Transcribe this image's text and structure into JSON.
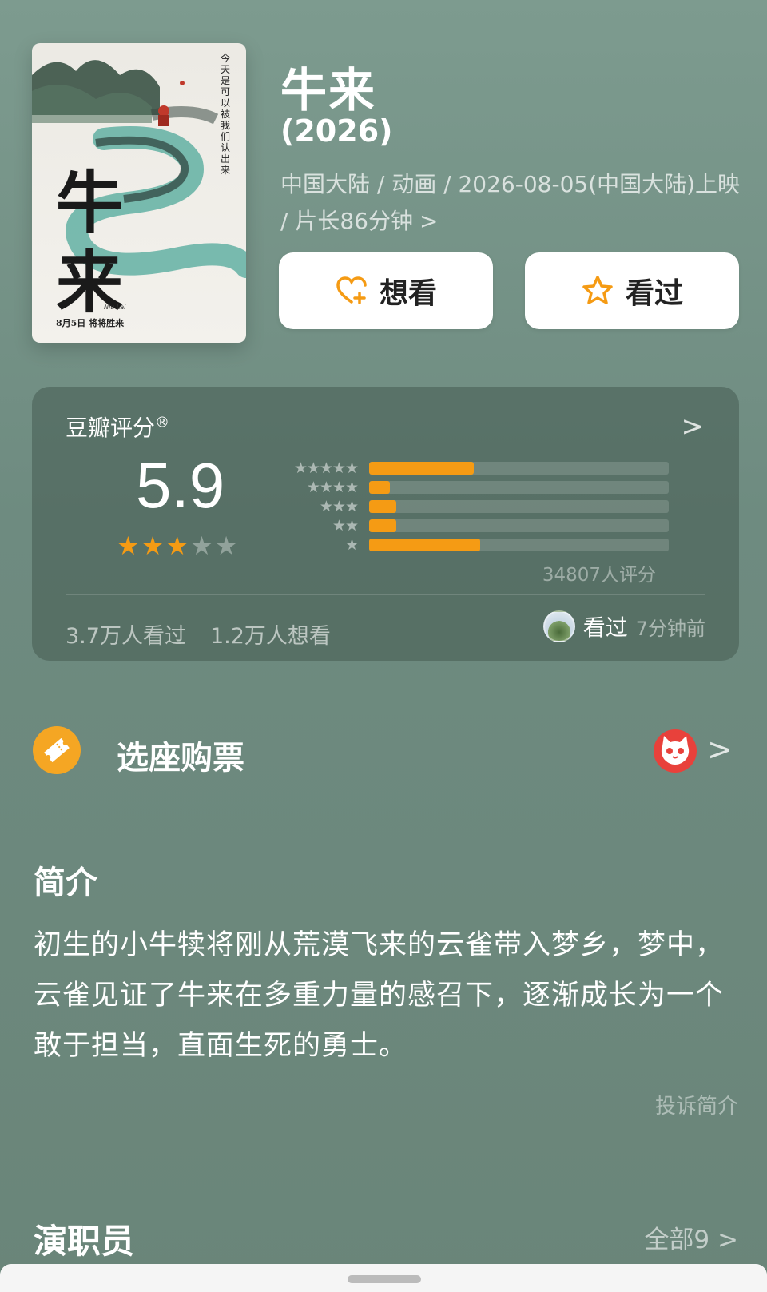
{
  "movie": {
    "title": "牛来",
    "year": "(2026)",
    "meta_line": "中国大陆 / 动画 / 2026-08-05(中国大陆)上映 / 片长86分钟",
    "meta_chevron": ">",
    "poster_text": {
      "vertical_caption": "今天是可以被我们认出来",
      "calligraphy": "牛来",
      "pinyin": "Niu Lai",
      "date_line": "8月5日 将将胜来"
    }
  },
  "actions": {
    "want_label": "想看",
    "seen_label": "看过"
  },
  "rating": {
    "title": "豆瓣评分",
    "title_mark": "®",
    "chevron": ">",
    "score": "5.9",
    "stars_filled": 3,
    "stars_total": 5,
    "distribution": [
      {
        "stars": "★★★★★",
        "fraction": 0.35
      },
      {
        "stars": "★★★★",
        "fraction": 0.07
      },
      {
        "stars": "★★★",
        "fraction": 0.09
      },
      {
        "stars": "★★",
        "fraction": 0.09
      },
      {
        "stars": "★",
        "fraction": 0.37
      }
    ],
    "count_text": "34807人评分",
    "seen_count": "3.7万人看过",
    "want_count": "1.2万人想看",
    "recent_action": "看过",
    "recent_time": "7分钟前"
  },
  "tickets": {
    "label": "选座购票",
    "chevron": ">"
  },
  "intro": {
    "heading": "简介",
    "text": "初生的小牛犊将刚从荒漠飞来的云雀带入梦乡，梦中，云雀见证了牛来在多重力量的感召下，逐渐成长为一个敢于担当，直面生死的勇士。",
    "report_label": "投诉简介"
  },
  "cast": {
    "heading": "演职员",
    "all_label": "全部9 >"
  },
  "colors": {
    "accent": "#f59b14",
    "background": "#6e8b80"
  }
}
